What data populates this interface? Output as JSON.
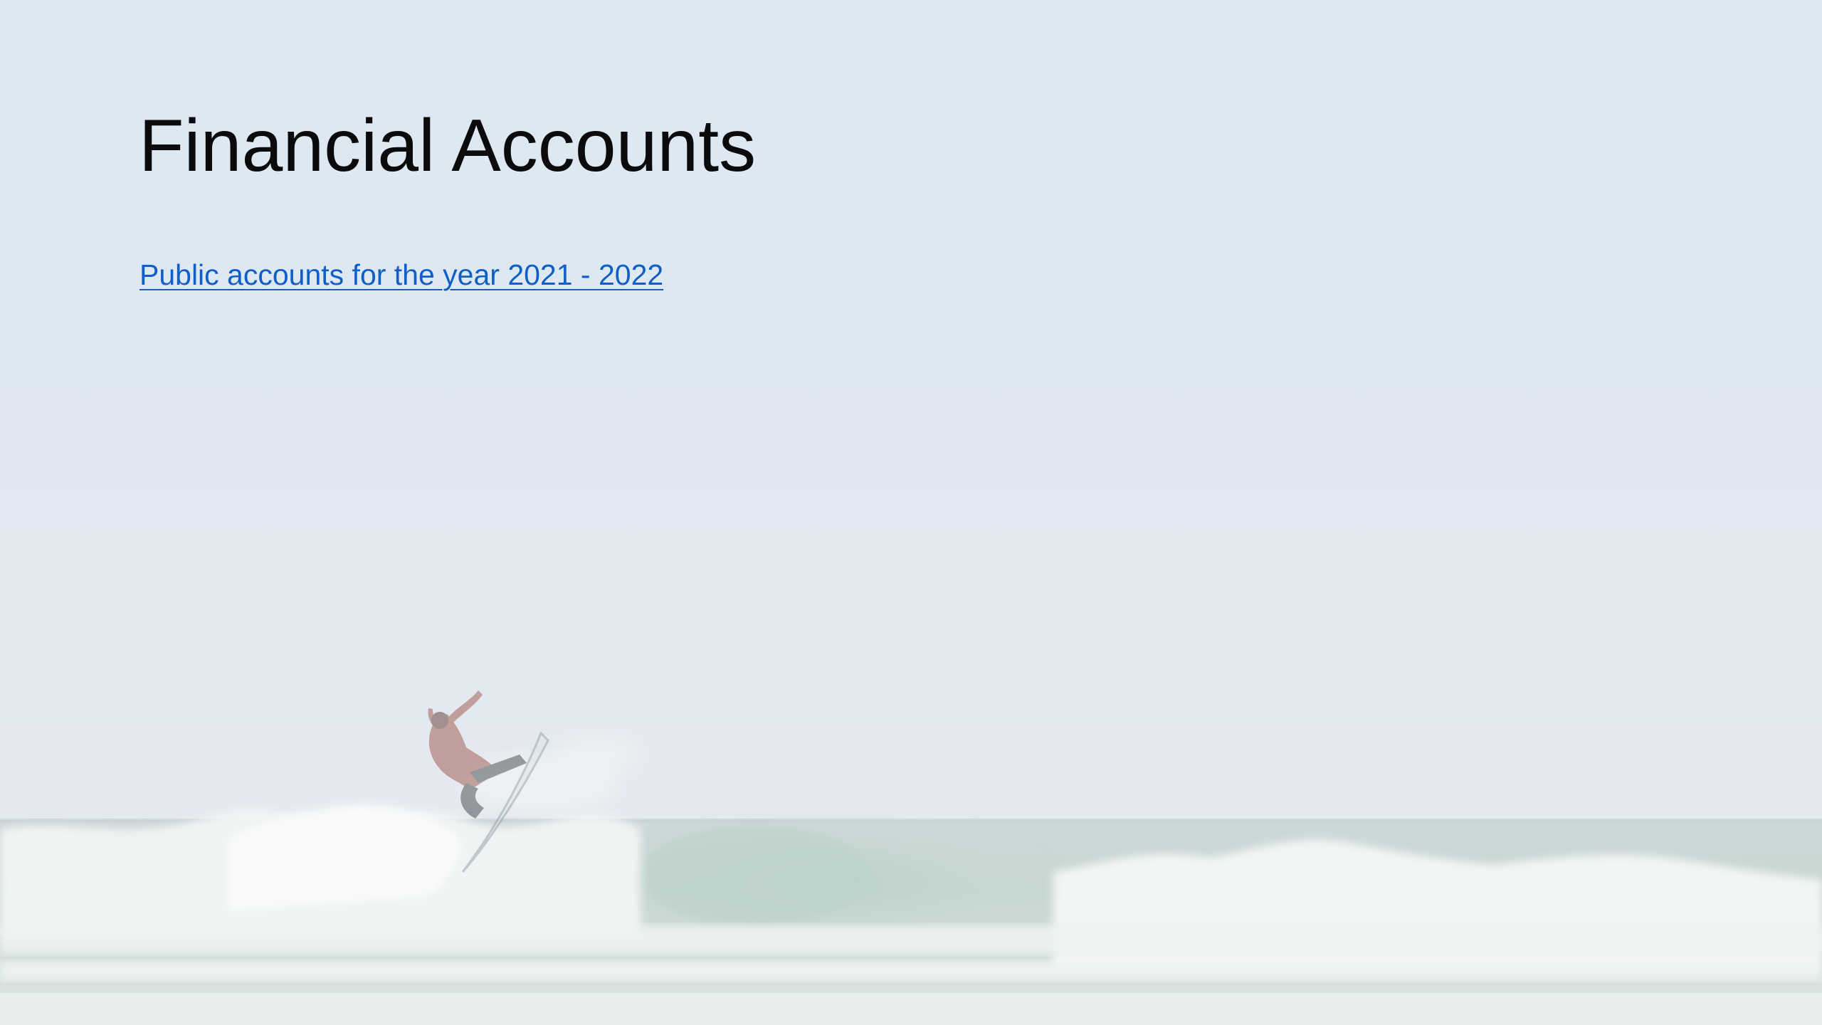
{
  "slide": {
    "title": "Financial Accounts",
    "link_text": "Public accounts for the year 2021 - 2022"
  },
  "background": {
    "image_subject": "surfer-on-wave",
    "sky_color": "#dde8f2",
    "sea_color": "#c9d6d4",
    "foam_color": "#f6f8f8"
  },
  "colors": {
    "title": "#0b0b0b",
    "link": "#0f5fc6"
  }
}
